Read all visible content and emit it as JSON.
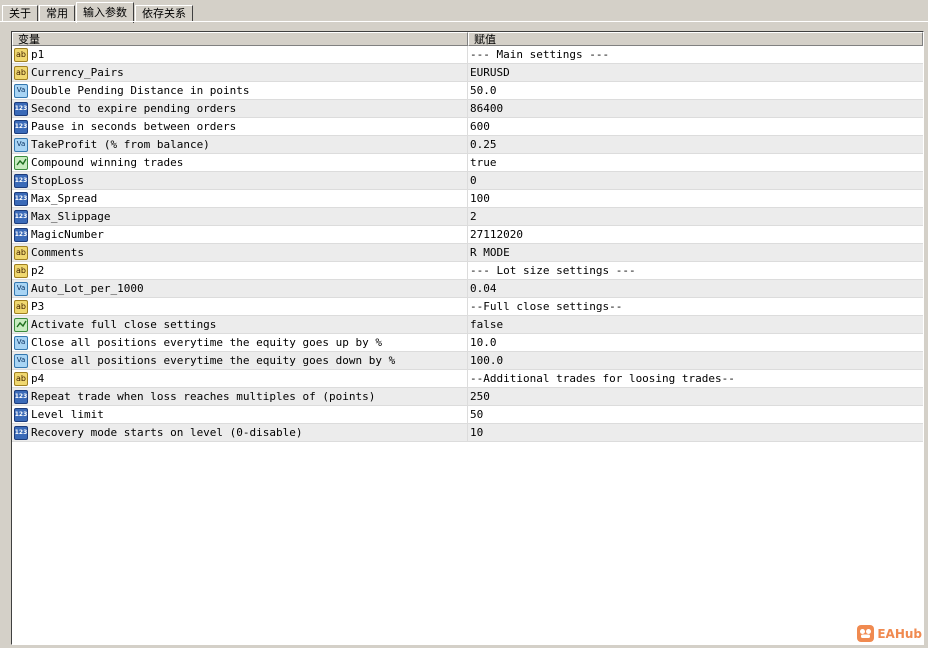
{
  "tabs": [
    {
      "label": "关于",
      "active": false
    },
    {
      "label": "常用",
      "active": false
    },
    {
      "label": "输入参数",
      "active": true
    },
    {
      "label": "依存关系",
      "active": false
    }
  ],
  "columns": {
    "variable": "变量",
    "value": "赋值"
  },
  "rows": [
    {
      "type": "str",
      "icon": "string-type-icon",
      "name": "p1",
      "value": "--- Main settings ---"
    },
    {
      "type": "str",
      "icon": "string-type-icon",
      "name": "Currency_Pairs",
      "value": "EURUSD"
    },
    {
      "type": "dbl",
      "icon": "double-type-icon",
      "name": "Double Pending Distance in points",
      "value": "50.0"
    },
    {
      "type": "int",
      "icon": "integer-type-icon",
      "name": "Second to expire pending orders",
      "value": "86400"
    },
    {
      "type": "int",
      "icon": "integer-type-icon",
      "name": "Pause in seconds between orders",
      "value": "600"
    },
    {
      "type": "dbl",
      "icon": "double-type-icon",
      "name": "TakeProfit (% from balance)",
      "value": "0.25"
    },
    {
      "type": "bool",
      "icon": "boolean-type-icon",
      "name": "Compound winning trades",
      "value": "true"
    },
    {
      "type": "int",
      "icon": "integer-type-icon",
      "name": "StopLoss",
      "value": "0"
    },
    {
      "type": "int",
      "icon": "integer-type-icon",
      "name": "Max_Spread",
      "value": "100"
    },
    {
      "type": "int",
      "icon": "integer-type-icon",
      "name": "Max_Slippage",
      "value": "2"
    },
    {
      "type": "int",
      "icon": "integer-type-icon",
      "name": "MagicNumber",
      "value": "27112020"
    },
    {
      "type": "str",
      "icon": "string-type-icon",
      "name": "Comments",
      "value": "R MODE"
    },
    {
      "type": "str",
      "icon": "string-type-icon",
      "name": "p2",
      "value": "--- Lot size settings ---"
    },
    {
      "type": "dbl",
      "icon": "double-type-icon",
      "name": "Auto_Lot_per_1000",
      "value": "0.04"
    },
    {
      "type": "str",
      "icon": "string-type-icon",
      "name": "P3",
      "value": "--Full close settings--"
    },
    {
      "type": "bool",
      "icon": "boolean-type-icon",
      "name": "Activate full close settings",
      "value": "false"
    },
    {
      "type": "dbl",
      "icon": "double-type-icon",
      "name": "Close all positions everytime the equity goes up by %",
      "value": "10.0"
    },
    {
      "type": "dbl",
      "icon": "double-type-icon",
      "name": "Close all positions everytime the equity goes down by %",
      "value": "100.0"
    },
    {
      "type": "str",
      "icon": "string-type-icon",
      "name": "p4",
      "value": "--Additional trades for loosing trades--"
    },
    {
      "type": "int",
      "icon": "integer-type-icon",
      "name": "Repeat trade when loss reaches multiples of (points)",
      "value": "250"
    },
    {
      "type": "int",
      "icon": "integer-type-icon",
      "name": "Level limit",
      "value": "50"
    },
    {
      "type": "int",
      "icon": "integer-type-icon",
      "name": "Recovery mode starts on level (0-disable)",
      "value": "10"
    }
  ],
  "watermark": {
    "text": "EAHub",
    "icon": "eahub-logo-icon"
  }
}
